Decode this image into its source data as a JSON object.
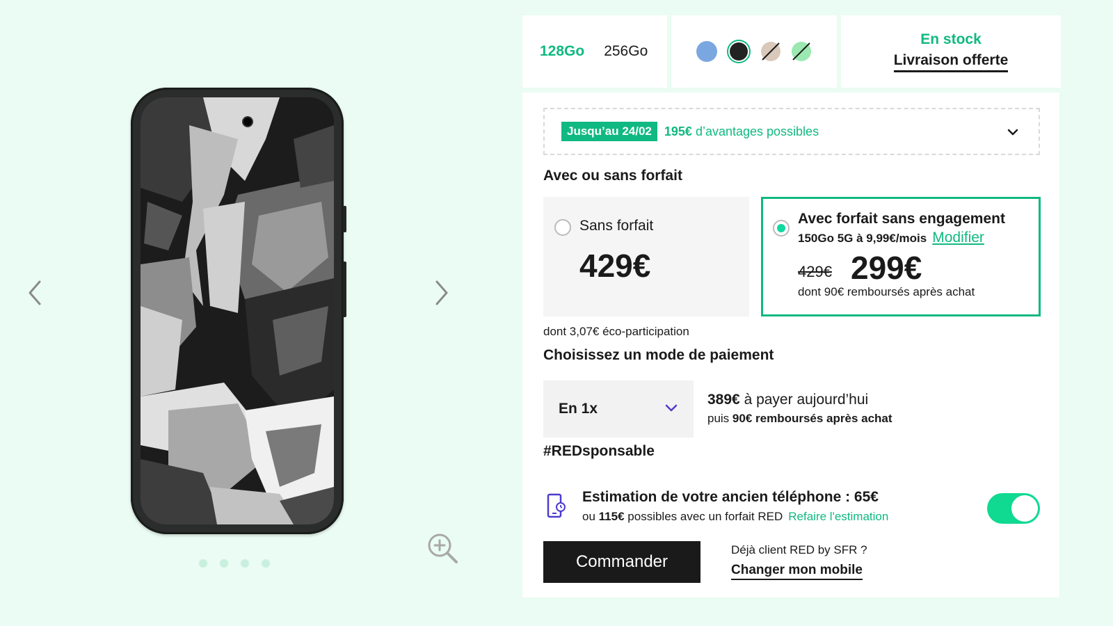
{
  "gallery": {
    "prev_icon": "chevron-left-icon",
    "next_icon": "chevron-right-icon",
    "zoom_icon": "zoom-in-icon",
    "dots_count": 4,
    "product_image": "smartphone-front"
  },
  "storage": {
    "options": [
      "128Go",
      "256Go"
    ],
    "selected": "128Go"
  },
  "colors": {
    "swatches": [
      "#7ba7e0",
      "#222222",
      "#d9c9bb",
      "#9be8b0"
    ],
    "selected": "#222222"
  },
  "availability": {
    "stock": "En stock",
    "delivery": "Livraison offerte"
  },
  "promo": {
    "badge": "Jusqu’au 24/02",
    "amount": "195€",
    "text": "d’avantages possibles"
  },
  "plan_section": {
    "title": "Avec ou sans forfait",
    "sans": {
      "label": "Sans forfait",
      "price": "429€"
    },
    "avec": {
      "label": "Avec forfait sans engagement",
      "plan": "150Go 5G à 9,99€/mois",
      "modify": "Modifier",
      "old_price": "429€",
      "price": "299€",
      "refund": "dont 90€ remboursés après achat"
    },
    "eco": "dont 3,07€ éco-participation"
  },
  "payment": {
    "title": "Choisissez un mode de paiement",
    "mode": "En 1x",
    "today_amount": "389€",
    "today_text": "à payer aujourd’hui",
    "then_prefix": "puis",
    "then_bold": "90€ remboursés après achat"
  },
  "responsable": {
    "title": "#REDsponsable",
    "estimate_title": "Estimation de votre ancien téléphone : 65€",
    "estimate_prefix": "ou",
    "estimate_amount": "115€",
    "estimate_text": "possibles avec un forfait RED",
    "estimate_link": "Refaire l'estimation",
    "toggle_on": true
  },
  "cta": {
    "order": "Commander",
    "existing_client": "Déjà client RED by SFR ?",
    "change_mobile": "Changer mon mobile"
  },
  "accent": "#10b981"
}
